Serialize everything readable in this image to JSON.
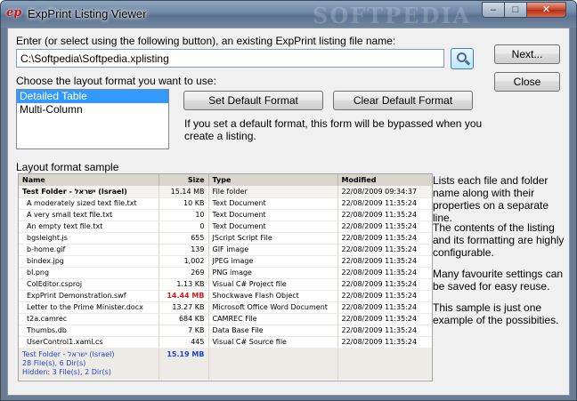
{
  "window": {
    "logo": "ep",
    "title": "ExpPrint Listing Viewer",
    "watermark": "SOFTPEDIA",
    "minimize": "–",
    "maximize": "□",
    "close": "✕"
  },
  "file_section": {
    "label": "Enter (or select using the following button), an existing ExpPrint listing file name:",
    "path_value": "C:\\Softpedia\\Softpedia.xplisting",
    "browse_icon": "magnifier-icon"
  },
  "buttons": {
    "next": "Next...",
    "close": "Close",
    "set_default": "Set Default Format",
    "clear_default": "Clear Default Format"
  },
  "format_section": {
    "label": "Choose the layout format you want to use:",
    "options": [
      "Detailed Table",
      "Multi-Column"
    ],
    "selected": "Detailed Table",
    "default_note_line1": "If you set a default format, this form will be bypassed when you",
    "default_note_line2": "create a listing."
  },
  "sample_section": {
    "label": "Layout format sample",
    "columns": [
      "Name",
      "Size",
      "Type",
      "Modified"
    ],
    "folder_row": {
      "name": "Test Folder - ישראל (Israel)",
      "size": "15.14 MB",
      "type": "File folder",
      "modified": "22/08/2009 09:34:37"
    },
    "rows": [
      {
        "name": "A moderately sized text file.txt",
        "size": "10 KB",
        "type": "Text Document",
        "modified": "22/08/2009 11:35:24",
        "indent": true,
        "hi": false
      },
      {
        "name": "A very small text file.txt",
        "size": "10",
        "type": "Text Document",
        "modified": "22/08/2009 11:35:24",
        "indent": true,
        "hi": false
      },
      {
        "name": "An empty text file.txt",
        "size": "0",
        "type": "Text Document",
        "modified": "22/08/2009 11:35:24",
        "indent": true,
        "hi": false
      },
      {
        "name": "bgsleight.js",
        "size": "655",
        "type": "JScript Script File",
        "modified": "22/08/2009 11:35:24",
        "indent": true,
        "hi": false
      },
      {
        "name": "b-home.gif",
        "size": "139",
        "type": "GIF image",
        "modified": "22/08/2009 11:35:24",
        "indent": true,
        "hi": false
      },
      {
        "name": "bindex.jpg",
        "size": "1,002",
        "type": "JPEG image",
        "modified": "22/08/2009 11:35:24",
        "indent": true,
        "hi": false
      },
      {
        "name": "bl.png",
        "size": "269",
        "type": "PNG image",
        "modified": "22/08/2009 11:35:24",
        "indent": true,
        "hi": false
      },
      {
        "name": "ColEditor.csproj",
        "size": "1.13 KB",
        "type": "Visual C# Project file",
        "modified": "22/08/2009 11:35:24",
        "indent": true,
        "hi": false
      },
      {
        "name": "ExpPrint Demonstration.swf",
        "size": "14.44 MB",
        "type": "Shockwave Flash Object",
        "modified": "22/08/2009 11:35:24",
        "indent": true,
        "hi": true
      },
      {
        "name": "Letter to the Prime Minister.docx",
        "size": "13.27 KB",
        "type": "Microsoft Office Word Document",
        "modified": "22/08/2009 11:35:24",
        "indent": true,
        "hi": false
      },
      {
        "name": "t2a.camrec",
        "size": "684 KB",
        "type": "CAMREC File",
        "modified": "22/08/2009 11:35:24",
        "indent": true,
        "hi": false
      },
      {
        "name": "Thumbs.db",
        "size": "7 KB",
        "type": "Data Base File",
        "modified": "22/08/2009 11:35:24",
        "indent": true,
        "hi": false
      },
      {
        "name": "UserControl1.xaml.cs",
        "size": "445",
        "type": "Visual C# Source file",
        "modified": "22/08/2009 11:35:24",
        "indent": true,
        "hi": false
      }
    ],
    "footer": {
      "line1": "Test Folder - ישראל (Israel)",
      "line2": "28 File(s), 6 Dir(s)",
      "line3": "Hidden: 3 File(s), 2 Dir(s)",
      "size": "15.19 MB"
    }
  },
  "side_notes": [
    "Lists each file and folder name along with their properties on a separate line.",
    "The contents of the listing and its formatting are highly configurable.",
    "Many favourite settings can be saved for easy reuse.",
    "This sample is just one example of the possibities."
  ],
  "colors": {
    "title_gradient": "#6f87a5",
    "selection": "#3399ff",
    "highlight_size": "#d81818",
    "footer_text": "#1f3fcf"
  }
}
